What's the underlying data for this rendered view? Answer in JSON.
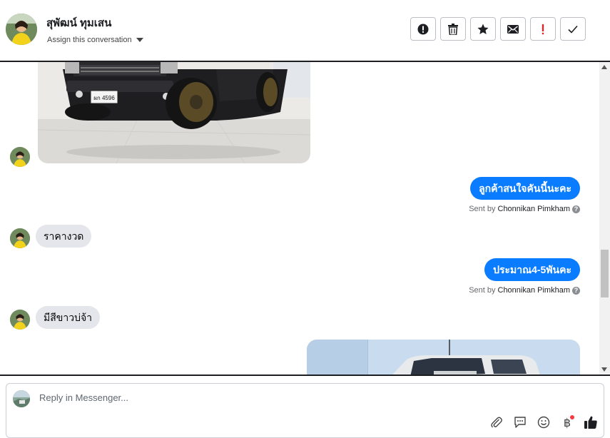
{
  "header": {
    "contact_name": "สุพัฒน์ ทุมเสน",
    "assign_label": "Assign this conversation",
    "actions": [
      {
        "name": "spam-icon",
        "label": "Mark as spam"
      },
      {
        "name": "trash-icon",
        "label": "Delete"
      },
      {
        "name": "star-icon",
        "label": "Star"
      },
      {
        "name": "envelope-icon",
        "label": "Mark as unread"
      },
      {
        "name": "exclamation-icon",
        "label": "Follow up"
      },
      {
        "name": "checkmark-icon",
        "label": "Mark as done"
      }
    ]
  },
  "messages": {
    "msg1_out": "ลูกค้าสนใจคันนี้นะคะ",
    "msg2_in": "ราคางวด",
    "msg3_out": "ประมาณ4-5พันคะ",
    "msg4_in": "มีสีขาวบ่จ้า",
    "sent_by_prefix": "Sent by",
    "sender_name": "Chonnikan Pimkham",
    "help_glyph": "?",
    "plate_text": "ผก 4596"
  },
  "composer": {
    "placeholder": "Reply in Messenger...",
    "tools": [
      "paperclip-icon",
      "saved-replies-icon",
      "emoji-icon",
      "baht-payment-icon",
      "thumbs-up-icon"
    ],
    "baht_glyph": "฿"
  },
  "colors": {
    "outgoing_bubble": "#0a7cff",
    "incoming_bubble": "#e4e6eb",
    "badge_dot": "#fa383e",
    "danger_icon": "#d8262f"
  }
}
